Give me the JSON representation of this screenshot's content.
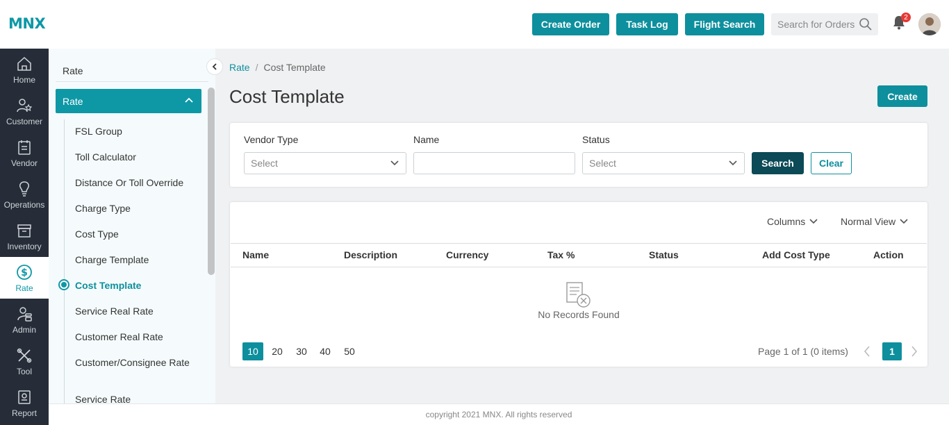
{
  "brand": {
    "logo_text": "MNX",
    "accent": "#0e98a6"
  },
  "header": {
    "buttons": [
      "Create Order",
      "Task Log",
      "Flight Search"
    ],
    "search_placeholder": "Search for Orders",
    "notification_count": "2"
  },
  "leftnav": [
    {
      "label": "Home",
      "icon": "home-icon"
    },
    {
      "label": "Customer",
      "icon": "customer-icon"
    },
    {
      "label": "Vendor",
      "icon": "vendor-icon"
    },
    {
      "label": "Operations",
      "icon": "lightbulb-icon"
    },
    {
      "label": "Inventory",
      "icon": "inventory-icon"
    },
    {
      "label": "Rate",
      "icon": "dollar-icon",
      "active": true
    },
    {
      "label": "Admin",
      "icon": "admin-icon"
    },
    {
      "label": "Tool",
      "icon": "tools-icon"
    },
    {
      "label": "Report",
      "icon": "report-icon"
    }
  ],
  "submenu": {
    "title": "Rate",
    "group": "Rate",
    "items": [
      "FSL Group",
      "Toll Calculator",
      "Distance Or Toll Override",
      "Charge Type",
      "Cost Type",
      "Charge Template",
      "Cost Template",
      "Service Real Rate",
      "Customer Real Rate",
      "Customer/Consignee Rate",
      "Service Rate"
    ],
    "active_item": "Cost Template"
  },
  "breadcrumb": {
    "parent": "Rate",
    "separator": "/",
    "current": "Cost Template"
  },
  "page": {
    "title": "Cost Template",
    "create_label": "Create"
  },
  "filters": {
    "vendor_type": {
      "label": "Vendor Type",
      "placeholder": "Select"
    },
    "name": {
      "label": "Name",
      "value": ""
    },
    "status": {
      "label": "Status",
      "placeholder": "Select"
    },
    "search_label": "Search",
    "clear_label": "Clear"
  },
  "table": {
    "columns_label": "Columns",
    "view_label": "Normal View",
    "headers": [
      "Name",
      "Description",
      "Currency",
      "Tax %",
      "Status",
      "Add Cost Type",
      "Action"
    ],
    "empty_text": "No Records Found"
  },
  "pagination": {
    "page_sizes": [
      "10",
      "20",
      "30",
      "40",
      "50"
    ],
    "selected_size": "10",
    "info": "Page 1 of 1 (0 items)",
    "current_page": "1"
  },
  "footer": {
    "text": "copyright 2021 MNX. All rights reserved"
  }
}
